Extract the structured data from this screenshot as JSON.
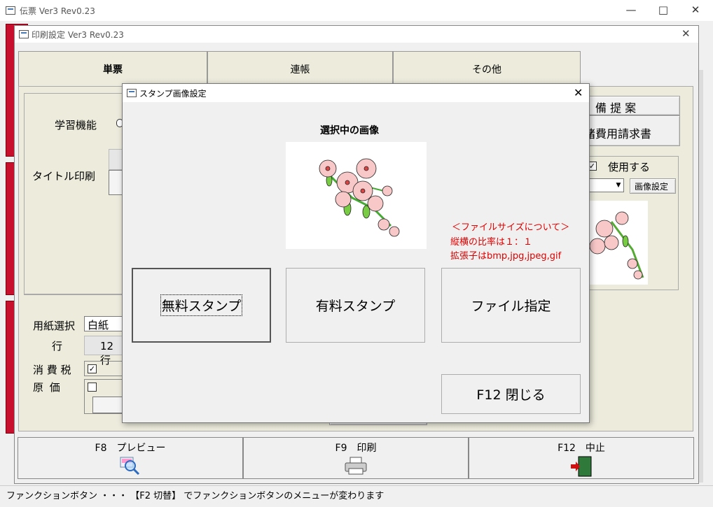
{
  "main_window": {
    "title": "伝票 Ver3 Rev0.23"
  },
  "print_settings_window": {
    "title": "印刷設定 Ver3 Rev0.23"
  },
  "tabs": [
    {
      "label": "単票",
      "active": true
    },
    {
      "label": "連帳",
      "active": false
    },
    {
      "label": "その他",
      "active": false
    }
  ],
  "settings_panel": {
    "learning_label": "学習機能",
    "title_print_label": "タイトル印刷",
    "paper_select_label": "用紙選択",
    "paper_value": "白紙",
    "row_label": "行",
    "row_value": "12行",
    "tax_label": "消 費 税",
    "cost_label": "原 価"
  },
  "right_panel": {
    "button_proposal": "備 提 案",
    "button_invoice": "諸費用請求書",
    "use_label": "使用する",
    "image_settings_button": "画像設定"
  },
  "stamp_dialog": {
    "title": "スタンプ画像設定",
    "selected_image_label": "選択中の画像",
    "file_size_heading": "＜ファイルサイズについて＞",
    "ratio_note": "縦横の比率は１：１",
    "ext_note": "拡張子はbmp,jpg,jpeg,gif",
    "free_stamp_button": "無料スタンプ",
    "paid_stamp_button": "有料スタンプ",
    "file_select_button": "ファイル指定",
    "close_button": "F12 閉じる"
  },
  "function_bar": [
    {
      "label": "F8　プレビュー",
      "icon": "preview-magnifier-icon"
    },
    {
      "label": "F9　印刷",
      "icon": "printer-icon"
    },
    {
      "label": "F12　中止",
      "icon": "exit-door-icon"
    }
  ],
  "status_bar": {
    "text": "ファンクションボタン ・・・ 【F2 切替】 でファンクションボタンのメニューが変わります"
  },
  "colors": {
    "accent_red": "#c8102e",
    "note_red": "#e00000",
    "panel_bg": "#ecebdc"
  }
}
